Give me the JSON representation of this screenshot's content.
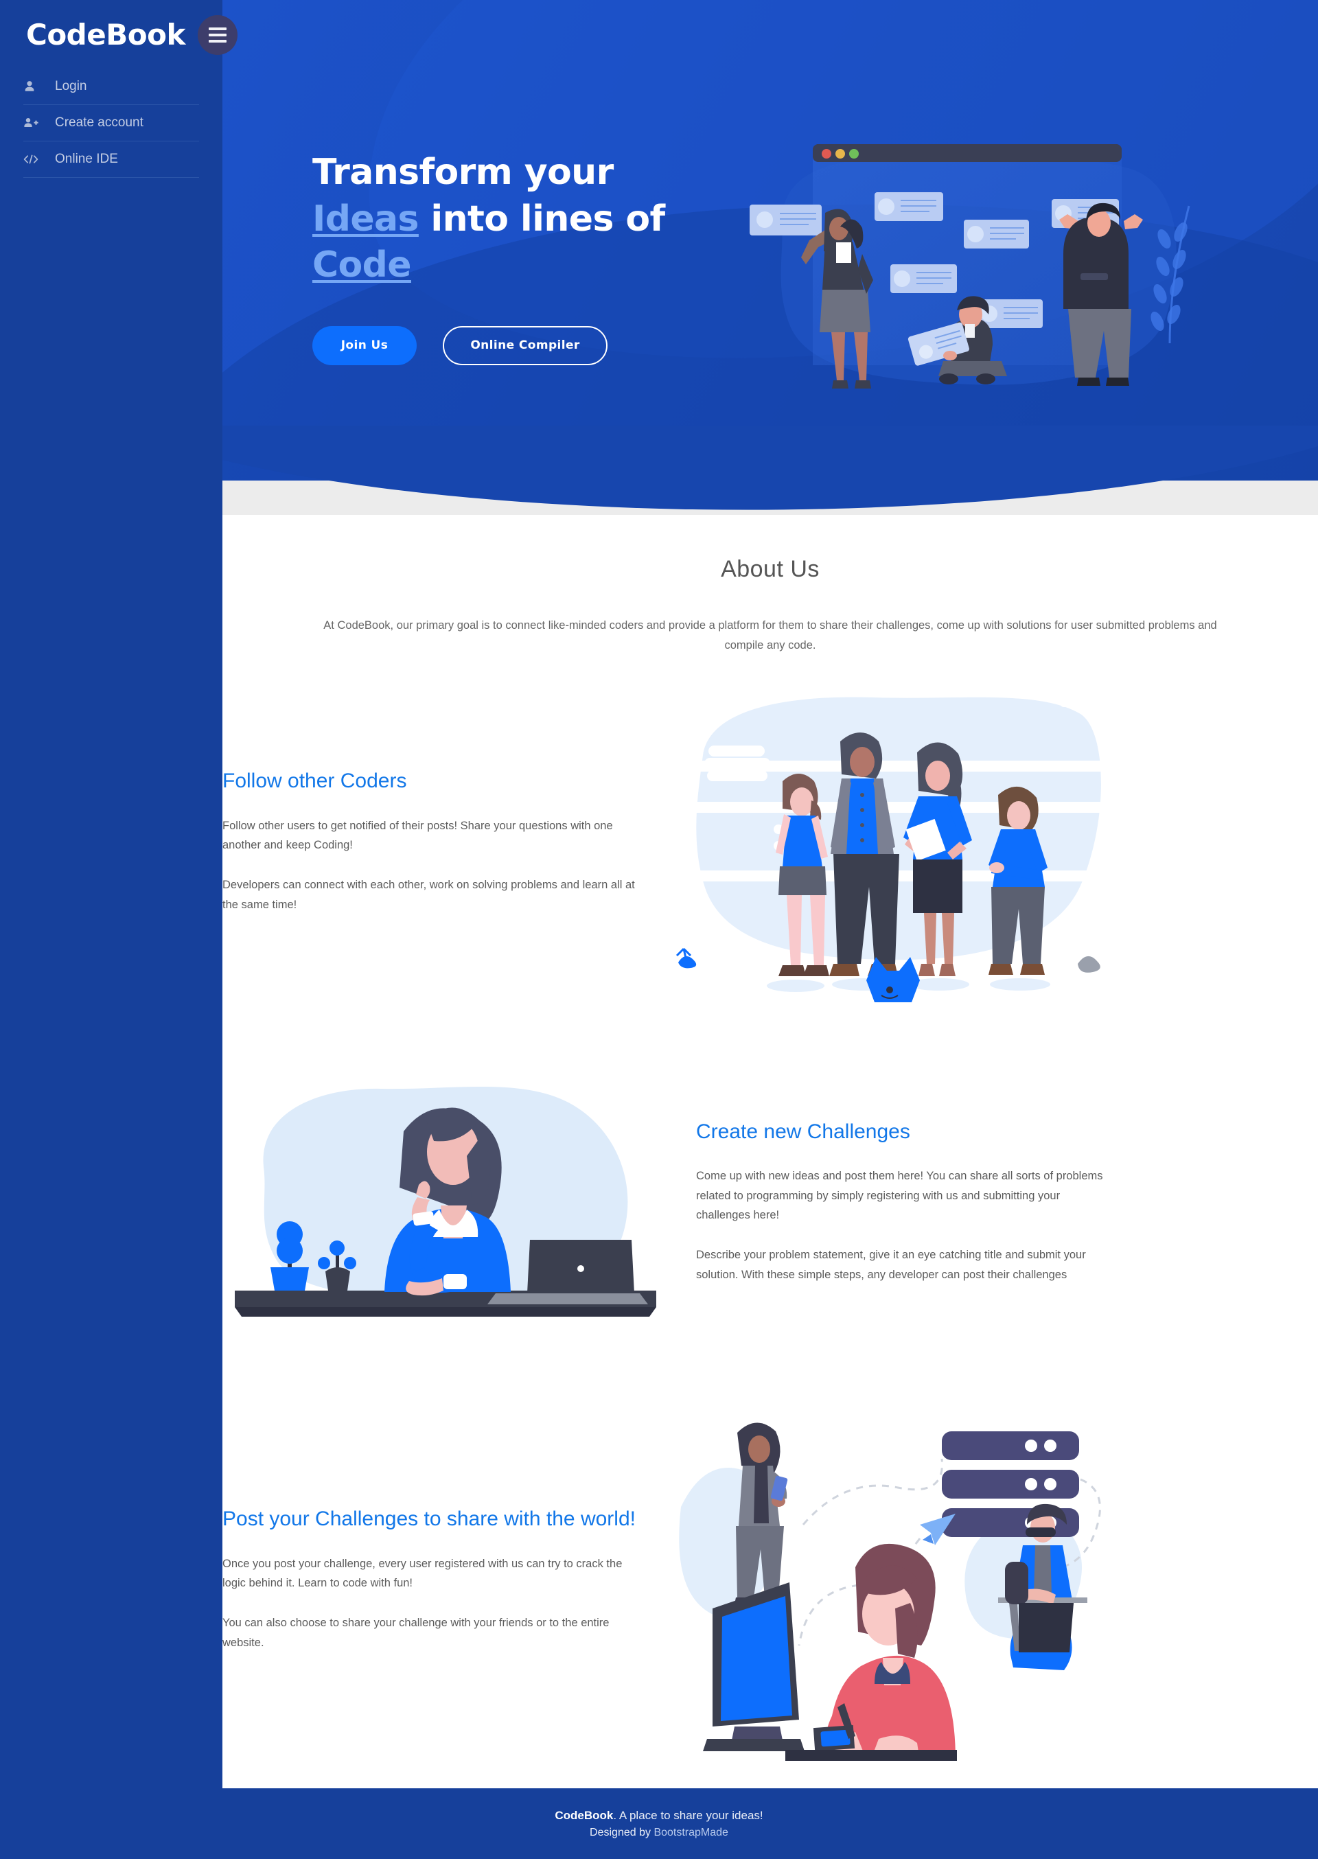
{
  "sidebar": {
    "logo": "CodeBook",
    "menu_icon": "hamburger-icon",
    "items": [
      {
        "label": "Login",
        "icon": "user-icon"
      },
      {
        "label": "Create account",
        "icon": "user-plus-icon"
      },
      {
        "label": "Online IDE",
        "icon": "code-brackets-icon"
      }
    ]
  },
  "hero": {
    "heading_line1": "Transform your",
    "heading_accent1": "Ideas",
    "heading_mid": " into lines of",
    "heading_accent2": "Code",
    "buttons": {
      "primary": "Join Us",
      "secondary": "Online Compiler"
    },
    "illustration": "team-pinning-profile-cards-on-browser-window"
  },
  "about": {
    "title": "About Us",
    "text": "At CodeBook, our primary goal is to connect like-minded coders and provide a platform for them to share their challenges, come up with solutions for user submitted problems and compile any code."
  },
  "features": [
    {
      "title": "Follow other Coders",
      "paragraphs": [
        "Follow other users to get notified of their posts! Share your questions with one another and keep Coding!",
        "Developers can connect with each other, work on solving problems and learn all at the same time!"
      ],
      "illustration": "group-of-four-people-standing-with-dog"
    },
    {
      "title": "Create new Challenges",
      "paragraphs": [
        "Come up with new ideas and post them here! You can share all sorts of problems related to programming by simply registering with us and submitting your challenges here!",
        "Describe your problem statement, give it an eye catching title and submit your solution. With these simple steps, any developer can post their challenges"
      ],
      "illustration": "woman-thinking-at-desk-with-laptop"
    },
    {
      "title": "Post your Challenges to share with the world!",
      "paragraphs": [
        "Once you post your challenge, every user registered with us can try to crack the logic behind it. Learn to code with fun!",
        "You can also choose to share your challenge with your friends or to the entire website."
      ],
      "illustration": "woman-at-computer-sharing-files-to-server-and-remote-users"
    }
  ],
  "footer": {
    "brand": "CodeBook",
    "tagline": ". A place to share your ideas!",
    "designed_prefix": "Designed by ",
    "designed_by": "BootstrapMade"
  },
  "colors": {
    "sidebar_blue": "#16409B",
    "hero_blue": "#1A4CBD",
    "accent_light_blue": "#76A7F5",
    "primary_button": "#0D6EFD",
    "feature_heading": "#1277E8",
    "gray_strip": "#ECECEC"
  }
}
